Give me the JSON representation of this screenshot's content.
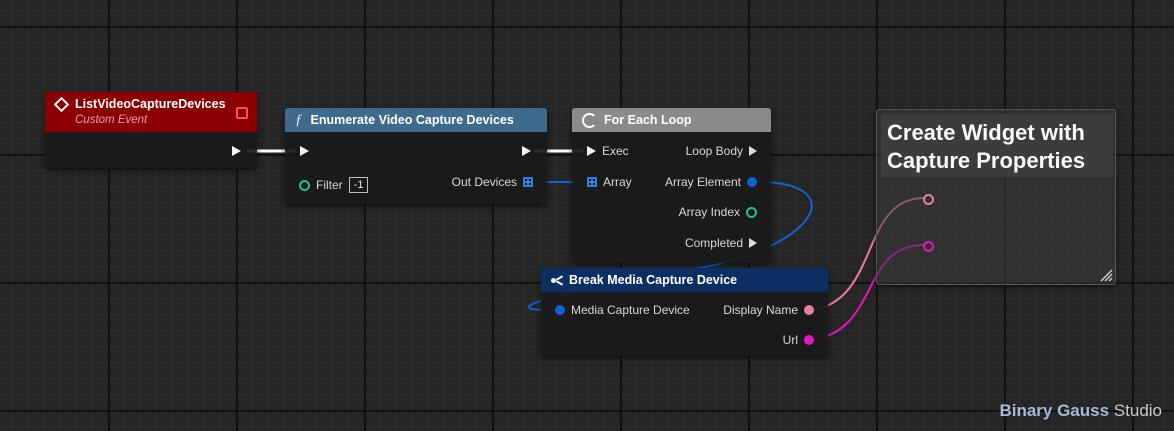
{
  "nodes": {
    "custom_event": {
      "title": "ListVideoCaptureDevices",
      "subtitle": "Custom Event",
      "header_color": "#8b0000"
    },
    "enumerate": {
      "title": "Enumerate Video Capture Devices",
      "function_icon": "ƒ",
      "header_color": "#3e6a8c",
      "filter_label": "Filter",
      "filter_value": "-1",
      "out_devices_label": "Out Devices"
    },
    "for_each": {
      "title": "For Each Loop",
      "header_color": "#8a8a8a",
      "exec_label": "Exec",
      "array_label": "Array",
      "loop_body_label": "Loop Body",
      "array_element_label": "Array Element",
      "array_index_label": "Array Index",
      "completed_label": "Completed"
    },
    "break_device": {
      "title": "Break Media Capture Device",
      "header_color": "#0c2f63",
      "input_label": "Media Capture Device",
      "display_name_label": "Display Name",
      "url_label": "Url"
    },
    "create_widget": {
      "title": "Create Widget with Capture Properties"
    }
  },
  "colors": {
    "exec_pin": "#f2f2f2",
    "struct_pin": "#1560d4",
    "int_pin": "#1ec29a",
    "string_pin": "#e47fa6",
    "text_pin": "#e018bf",
    "wire_exec": "#ffffff"
  },
  "watermark": {
    "bold": "Binary Gauss",
    "normal": "Studio"
  }
}
